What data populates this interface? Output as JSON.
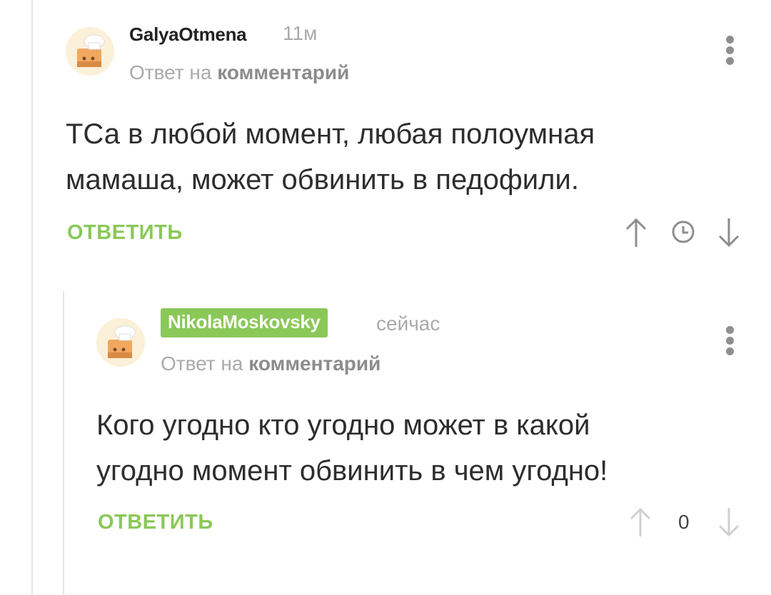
{
  "comments": [
    {
      "username": "GalyaOtmena",
      "time": "11м",
      "reply_prefix": "Ответ на ",
      "reply_target": "комментарий",
      "text_lines": [
        "ТСа в любой момент, любая полоумная",
        "мамаша, может обвинить в педофили."
      ],
      "reply_label": "ОТВЕТИТЬ",
      "rating_icon": "clock-icon"
    },
    {
      "username": "NikolaMoskovsky",
      "time": "сейчас",
      "reply_prefix": "Ответ на ",
      "reply_target": "комментарий",
      "text_lines": [
        "Кого угодно кто угодно может в какой",
        "угодно момент обвинить в чем угодно!"
      ],
      "reply_label": "ОТВЕТИТЬ",
      "rating": "0"
    }
  ],
  "colors": {
    "accent": "#8ac858",
    "text": "#2d2d2d",
    "muted": "#aaaaaa"
  }
}
